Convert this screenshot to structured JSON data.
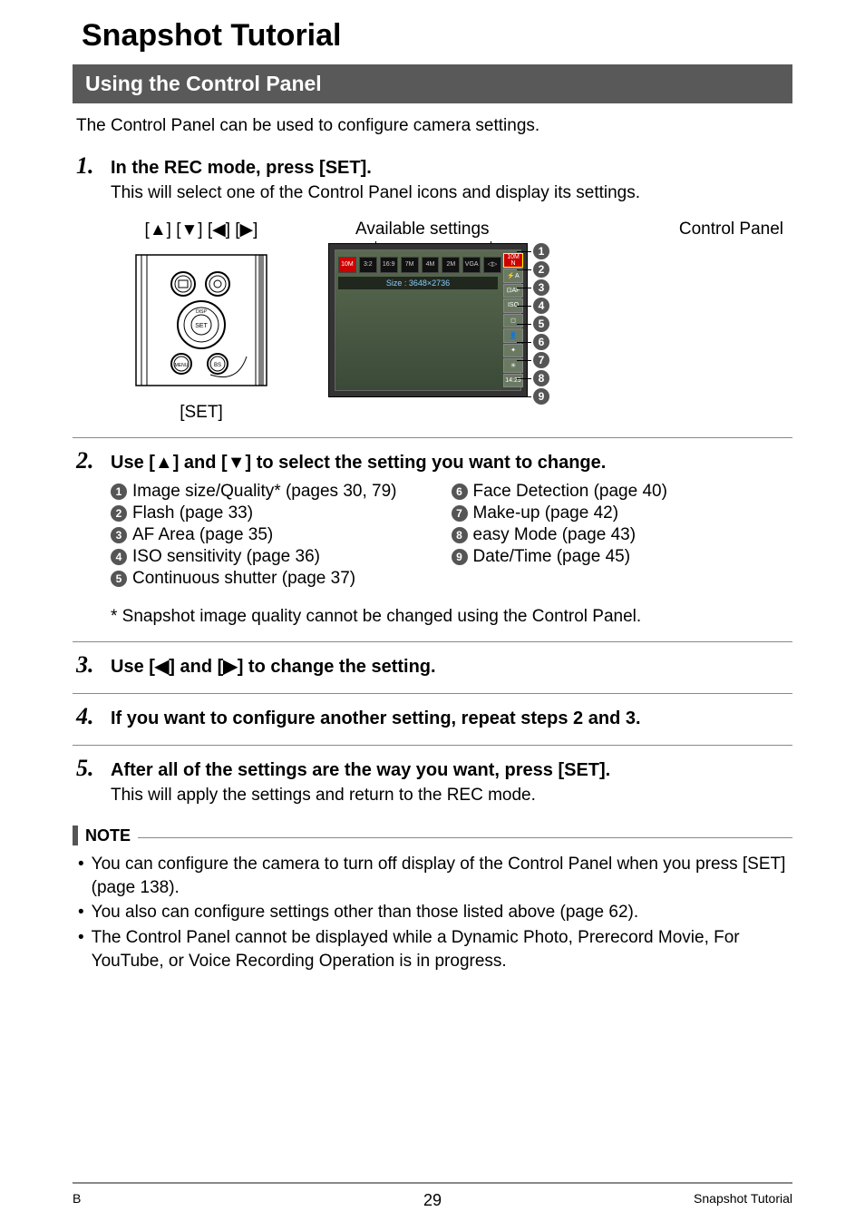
{
  "page_title": "Snapshot Tutorial",
  "section_title": "Using the Control Panel",
  "intro": "The Control Panel can be used to configure camera settings.",
  "steps": {
    "s1": {
      "num": "1.",
      "title": "In the REC mode, press [SET].",
      "sub": "This will select one of the Control Panel icons and display its settings."
    },
    "s2": {
      "num": "2.",
      "title_prefix": "Use [",
      "title_mid": "] and [",
      "title_suffix": "] to select the setting you want to change."
    },
    "s3": {
      "num": "3.",
      "title_prefix": "Use [",
      "title_mid": "] and [",
      "title_suffix": "] to change the setting."
    },
    "s4": {
      "num": "4.",
      "title": "If you want to configure another setting, repeat steps 2 and 3."
    },
    "s5": {
      "num": "5.",
      "title": "After all of the settings are the way you want, press [SET].",
      "sub": "This will apply the settings and return to the REC mode."
    }
  },
  "fig_labels": {
    "dpad": "[▲] [▼] [◀] [▶]",
    "set": "[SET]",
    "available": "Available settings",
    "control_panel": "Control Panel"
  },
  "screen": {
    "caption": "Size : 3648×2736",
    "strip": [
      "10M",
      "3:2",
      "16:9",
      "7M",
      "4M",
      "2M",
      "VGA",
      "◁▷"
    ],
    "side": [
      "10M N",
      "⚡A",
      "⊡AF",
      "ISO",
      "◻",
      "👤",
      "✦",
      "✳",
      "14:29"
    ]
  },
  "settings_left": [
    {
      "n": "1",
      "label": "Image size/Quality* (pages 30, 79)"
    },
    {
      "n": "2",
      "label": "Flash (page 33)"
    },
    {
      "n": "3",
      "label": "AF Area (page 35)"
    },
    {
      "n": "4",
      "label": "ISO sensitivity (page 36)"
    },
    {
      "n": "5",
      "label": "Continuous shutter (page 37)"
    }
  ],
  "settings_right": [
    {
      "n": "6",
      "label": "Face Detection (page 40)"
    },
    {
      "n": "7",
      "label": "Make-up (page 42)"
    },
    {
      "n": "8",
      "label": "easy Mode (page 43)"
    },
    {
      "n": "9",
      "label": "Date/Time (page 45)"
    }
  ],
  "footnote": "* Snapshot image quality cannot be changed using the Control Panel.",
  "note_label": "NOTE",
  "notes": [
    "You can configure the camera to turn off display of the Control Panel when you press [SET] (page 138).",
    "You also can configure settings other than those listed above (page 62).",
    "The Control Panel cannot be displayed while a Dynamic Photo, Prerecord Movie, For YouTube, or Voice Recording Operation is in progress."
  ],
  "footer": {
    "left": "B",
    "center": "29",
    "right": "Snapshot Tutorial"
  },
  "callout_nums": [
    "1",
    "2",
    "3",
    "4",
    "5",
    "6",
    "7",
    "8",
    "9"
  ]
}
